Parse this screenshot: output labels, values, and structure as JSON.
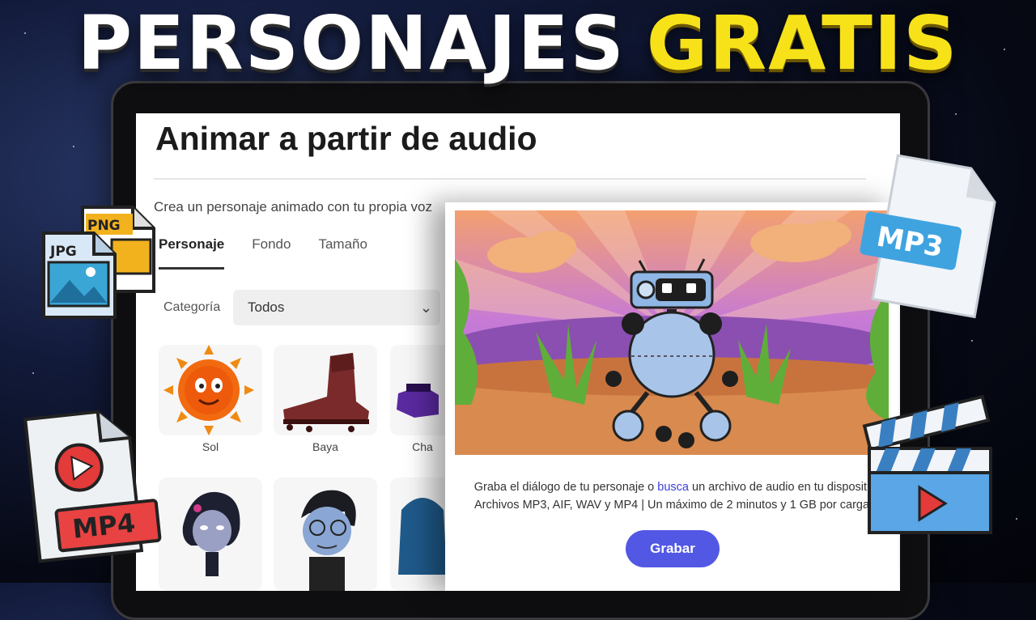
{
  "headline": {
    "part1": "PERSONAJES",
    "part2": "GRATIS"
  },
  "page": {
    "title": "Animar a partir de audio",
    "subtitle": "Crea un personaje animado con tu propia voz",
    "tabs": [
      {
        "label": "Personaje"
      },
      {
        "label": "Fondo"
      },
      {
        "label": "Tamaño"
      }
    ],
    "category_label": "Categoría",
    "category_value": "Todos",
    "characters": [
      {
        "label": "Sol"
      },
      {
        "label": "Baya"
      },
      {
        "label": "Cha"
      }
    ]
  },
  "popup": {
    "line1_pre": "Graba el diálogo de tu personaje o",
    "line1_link": "busca",
    "line1_post": "un archivo de audio en tu dispositi",
    "line2": "Archivos MP3, AIF, WAV y MP4 | Un máximo de 2 minutos y 1 GB por carga",
    "record_label": "Grabar"
  },
  "file_badges": {
    "png": "PNG",
    "jpg": "JPG",
    "mp3": "MP3",
    "mp4": "MP4"
  },
  "colors": {
    "accent": "#5258e4",
    "headline_yellow": "#f7e21a",
    "link": "#3d3fd6"
  }
}
